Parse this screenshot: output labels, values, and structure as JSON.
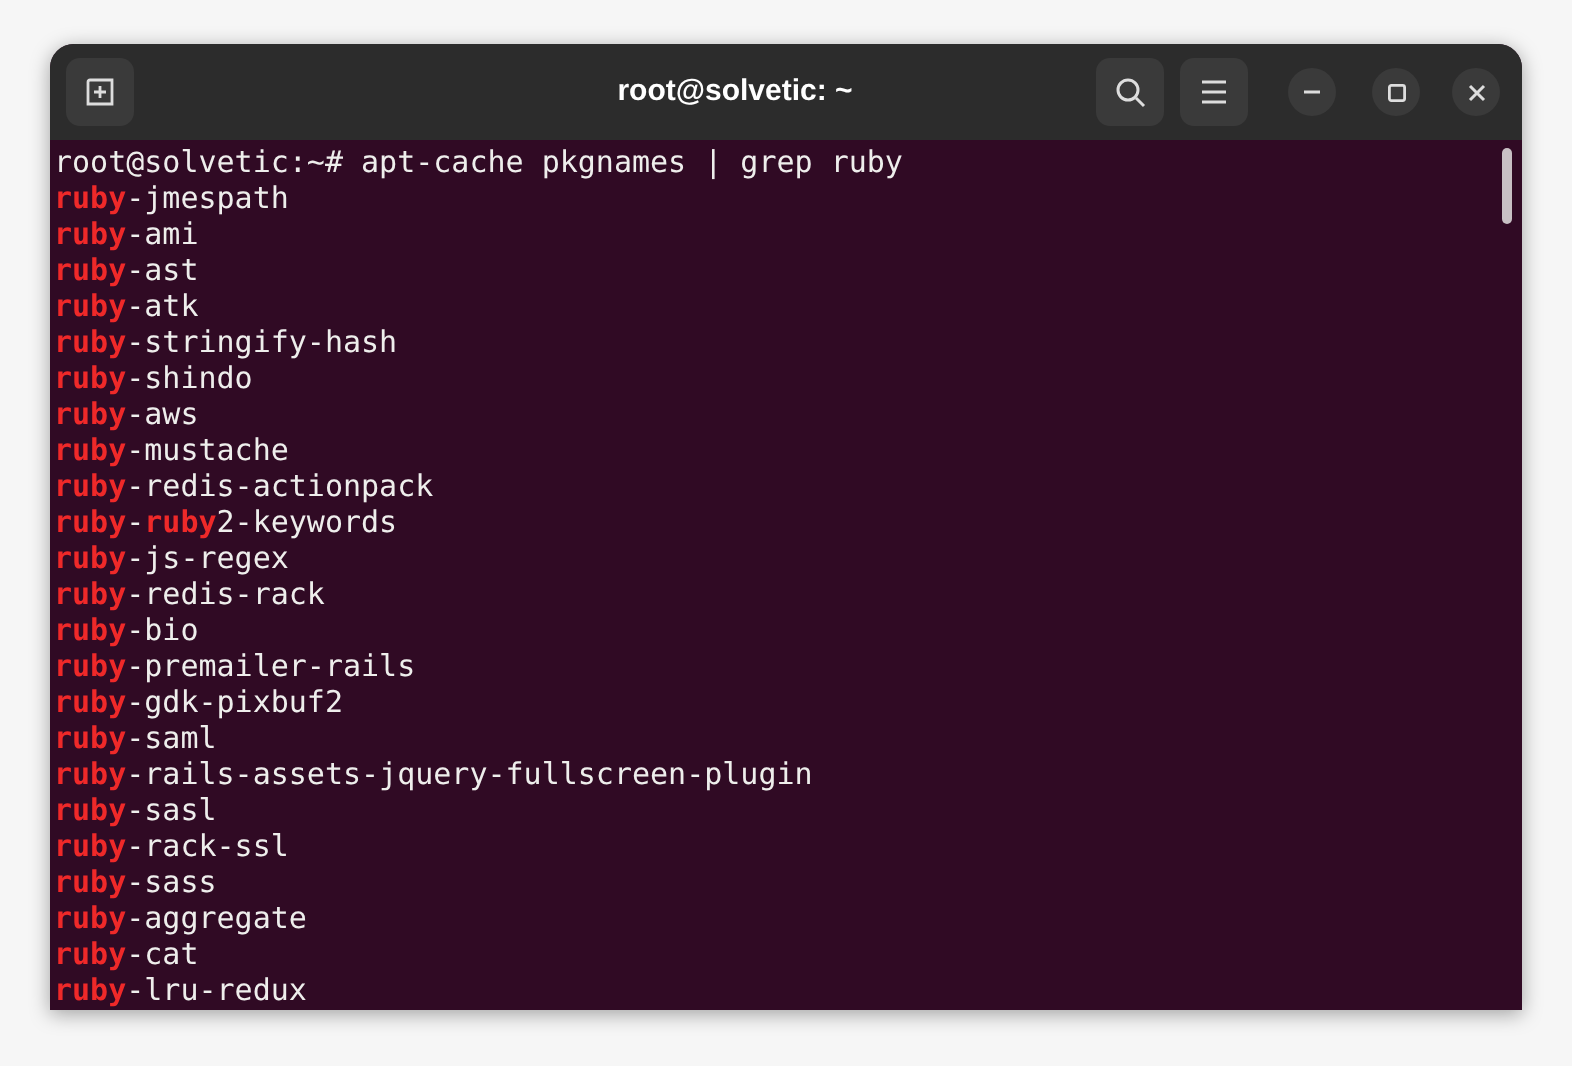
{
  "window": {
    "title": "root@solvetic: ~"
  },
  "terminal": {
    "prompt": "root@solvetic:~# ",
    "command": "apt-cache pkgnames | grep ruby",
    "lines": [
      [
        {
          "text": "ruby",
          "match": true
        },
        {
          "text": "-jmespath",
          "match": false
        }
      ],
      [
        {
          "text": "ruby",
          "match": true
        },
        {
          "text": "-ami",
          "match": false
        }
      ],
      [
        {
          "text": "ruby",
          "match": true
        },
        {
          "text": "-ast",
          "match": false
        }
      ],
      [
        {
          "text": "ruby",
          "match": true
        },
        {
          "text": "-atk",
          "match": false
        }
      ],
      [
        {
          "text": "ruby",
          "match": true
        },
        {
          "text": "-stringify-hash",
          "match": false
        }
      ],
      [
        {
          "text": "ruby",
          "match": true
        },
        {
          "text": "-shindo",
          "match": false
        }
      ],
      [
        {
          "text": "ruby",
          "match": true
        },
        {
          "text": "-aws",
          "match": false
        }
      ],
      [
        {
          "text": "ruby",
          "match": true
        },
        {
          "text": "-mustache",
          "match": false
        }
      ],
      [
        {
          "text": "ruby",
          "match": true
        },
        {
          "text": "-redis-actionpack",
          "match": false
        }
      ],
      [
        {
          "text": "ruby",
          "match": true
        },
        {
          "text": "-",
          "match": false
        },
        {
          "text": "ruby",
          "match": true
        },
        {
          "text": "2-keywords",
          "match": false
        }
      ],
      [
        {
          "text": "ruby",
          "match": true
        },
        {
          "text": "-js-regex",
          "match": false
        }
      ],
      [
        {
          "text": "ruby",
          "match": true
        },
        {
          "text": "-redis-rack",
          "match": false
        }
      ],
      [
        {
          "text": "ruby",
          "match": true
        },
        {
          "text": "-bio",
          "match": false
        }
      ],
      [
        {
          "text": "ruby",
          "match": true
        },
        {
          "text": "-premailer-rails",
          "match": false
        }
      ],
      [
        {
          "text": "ruby",
          "match": true
        },
        {
          "text": "-gdk-pixbuf2",
          "match": false
        }
      ],
      [
        {
          "text": "ruby",
          "match": true
        },
        {
          "text": "-saml",
          "match": false
        }
      ],
      [
        {
          "text": "ruby",
          "match": true
        },
        {
          "text": "-rails-assets-jquery-fullscreen-plugin",
          "match": false
        }
      ],
      [
        {
          "text": "ruby",
          "match": true
        },
        {
          "text": "-sasl",
          "match": false
        }
      ],
      [
        {
          "text": "ruby",
          "match": true
        },
        {
          "text": "-rack-ssl",
          "match": false
        }
      ],
      [
        {
          "text": "ruby",
          "match": true
        },
        {
          "text": "-sass",
          "match": false
        }
      ],
      [
        {
          "text": "ruby",
          "match": true
        },
        {
          "text": "-aggregate",
          "match": false
        }
      ],
      [
        {
          "text": "ruby",
          "match": true
        },
        {
          "text": "-cat",
          "match": false
        }
      ],
      [
        {
          "text": "ruby",
          "match": true
        },
        {
          "text": "-lru-redux",
          "match": false
        }
      ]
    ]
  }
}
